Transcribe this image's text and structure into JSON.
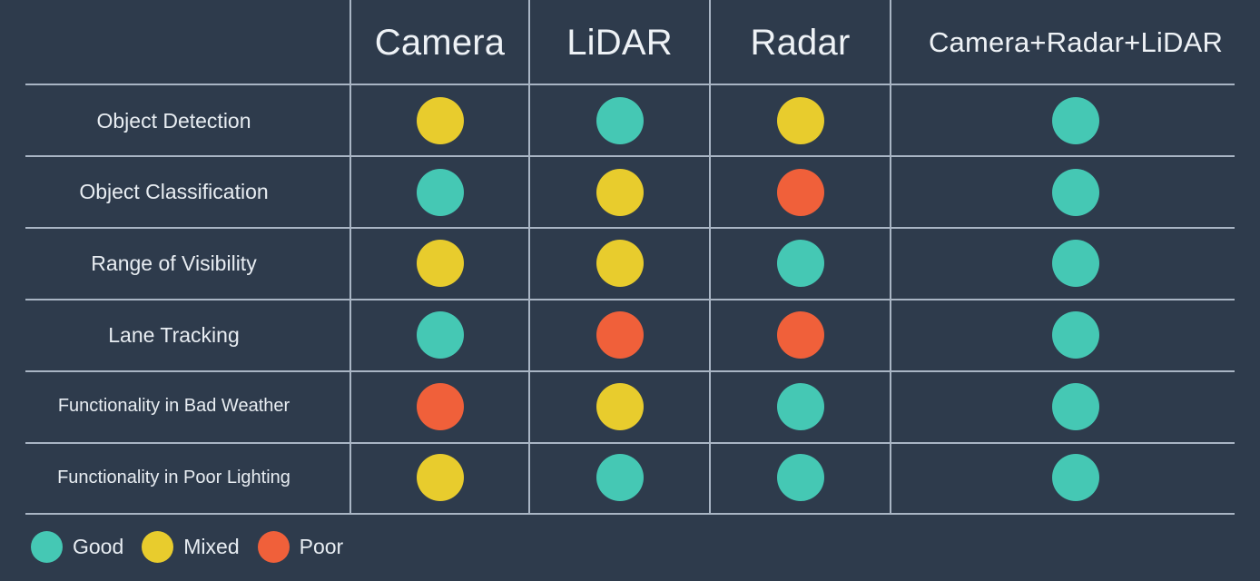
{
  "palette": {
    "background": "#2E3B4C",
    "grid_line": "#A9B5C4",
    "text": "#E8EDF2",
    "good": "#45C8B4",
    "mixed": "#E8CC2D",
    "poor": "#F0603A"
  },
  "table": {
    "corner_label": "",
    "columns": [
      {
        "label": "Camera"
      },
      {
        "label": "LiDAR"
      },
      {
        "label": "Radar"
      },
      {
        "label": "Camera+Radar+LiDAR"
      }
    ],
    "rows": [
      {
        "label": "Object Detection",
        "ratings": [
          "mixed",
          "good",
          "mixed",
          "good"
        ]
      },
      {
        "label": "Object Classification",
        "ratings": [
          "good",
          "mixed",
          "poor",
          "good"
        ]
      },
      {
        "label": "Range of Visibility",
        "ratings": [
          "mixed",
          "mixed",
          "good",
          "good"
        ]
      },
      {
        "label": "Lane Tracking",
        "ratings": [
          "good",
          "poor",
          "poor",
          "good"
        ]
      },
      {
        "label": "Functionality in Bad Weather",
        "ratings": [
          "poor",
          "mixed",
          "good",
          "good"
        ]
      },
      {
        "label": "Functionality in Poor Lighting",
        "ratings": [
          "mixed",
          "good",
          "good",
          "good"
        ]
      }
    ]
  },
  "legend": {
    "items": [
      {
        "key": "good",
        "label": "Good"
      },
      {
        "key": "mixed",
        "label": "Mixed"
      },
      {
        "key": "poor",
        "label": "Poor"
      }
    ]
  },
  "chart_data": {
    "type": "heatmap",
    "title": "",
    "xlabel": "",
    "ylabel": "",
    "categories": [
      "Camera",
      "LiDAR",
      "Radar",
      "Camera+Radar+LiDAR"
    ],
    "rows": [
      "Object Detection",
      "Object Classification",
      "Range of Visibility",
      "Lane Tracking",
      "Functionality in Bad Weather",
      "Functionality in Poor Lighting"
    ],
    "value_scale": [
      "poor",
      "mixed",
      "good"
    ],
    "values": [
      [
        "mixed",
        "good",
        "mixed",
        "good"
      ],
      [
        "good",
        "mixed",
        "poor",
        "good"
      ],
      [
        "mixed",
        "mixed",
        "good",
        "good"
      ],
      [
        "good",
        "poor",
        "poor",
        "good"
      ],
      [
        "poor",
        "mixed",
        "good",
        "good"
      ],
      [
        "mixed",
        "good",
        "good",
        "good"
      ]
    ],
    "legend": [
      "Good",
      "Mixed",
      "Poor"
    ],
    "legend_position": "bottom-left",
    "grid": true
  }
}
